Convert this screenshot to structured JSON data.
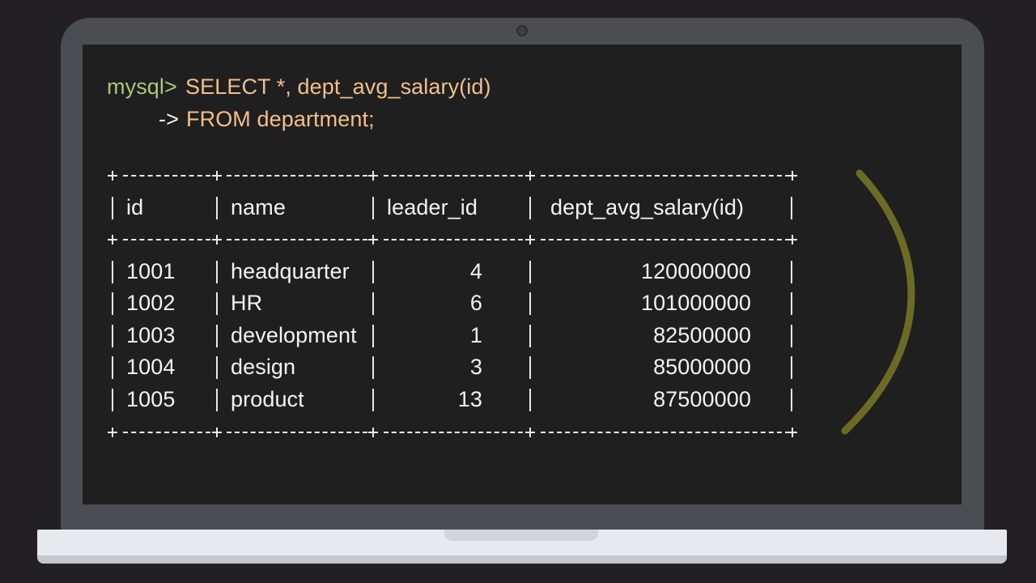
{
  "terminal": {
    "prompt": "mysql>",
    "command_line1": "SELECT *, dept_avg_salary(id)",
    "continuation_prompt": "->",
    "command_line2": "FROM department;"
  },
  "table": {
    "columns": [
      "id",
      "name",
      "leader_id",
      "dept_avg_salary(id)"
    ],
    "rows": [
      [
        "1001",
        "headquarter",
        "4",
        "120000000"
      ],
      [
        "1002",
        "HR",
        "6",
        "101000000"
      ],
      [
        "1003",
        "development",
        "1",
        "82500000"
      ],
      [
        "1004",
        "design",
        "3",
        "85000000"
      ],
      [
        "1005",
        "product",
        "13",
        "87500000"
      ]
    ]
  },
  "colors": {
    "prompt": "#a8c77a",
    "command": "#f1c08a",
    "table_text": "#f3f3f1",
    "bracket": "#6b6b24",
    "screen_background": "#201f20",
    "laptop_bezel": "#4a4d52"
  },
  "icons": {
    "bracket_decoration": "right-parenthesis-curve"
  }
}
